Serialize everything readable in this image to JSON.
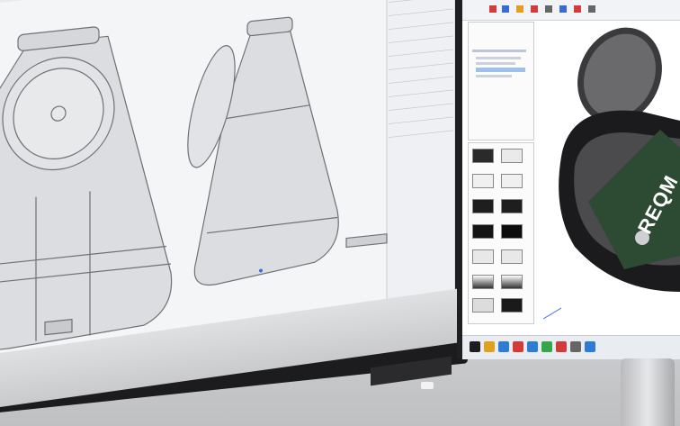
{
  "scene": {
    "description_free": true
  },
  "left_monitor": {
    "toolbar_right_label": "..."
  },
  "right_monitor": {
    "tree_items": [
      "",
      "",
      "",
      "",
      ""
    ],
    "thumbnails_caption": "",
    "logo_text": "REQM"
  },
  "taskbar": {
    "icons": [
      "search-icon",
      "folder-icon",
      "browser-icon",
      "app-icon",
      "app-icon",
      "app-icon",
      "app-icon",
      "app-icon",
      "app-icon"
    ]
  },
  "colors": {
    "screen_bg": "#f4f5f7",
    "pcb_green": "#2d4a32",
    "bezel": "#1c1c1e"
  }
}
